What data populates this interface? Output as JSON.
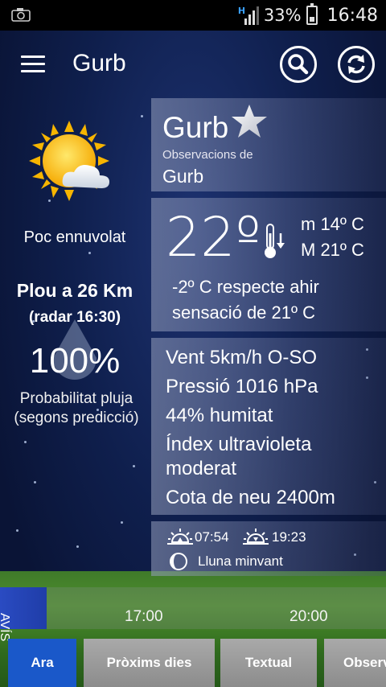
{
  "status_bar": {
    "network": "H",
    "battery": "33%",
    "time": "16:48",
    "icons": [
      "camera-icon",
      "signal-icon",
      "battery-icon"
    ]
  },
  "appbar": {
    "title": "Gurb",
    "icons": [
      "menu-icon",
      "search-icon",
      "refresh-icon"
    ]
  },
  "current": {
    "condition": "Poc ennuvolat",
    "condition_icon": "partly-cloudy-icon"
  },
  "rain": {
    "distance": "Plou a 26 Km",
    "radar": "(radar 16:30)",
    "probability": "100%",
    "probability_label_line1": "Probabilitat pluja",
    "probability_label_line2": "(segons predicció)"
  },
  "location": {
    "name": "Gurb",
    "observations_label": "Observacions de",
    "observations_location": "Gurb"
  },
  "temperature": {
    "current": "22º",
    "min": "m 14º C",
    "max": "M 21º C",
    "diff": "-2º C respecte ahir",
    "feels_like": "sensació de 21º C"
  },
  "details": {
    "wind": "Vent 5km/h O-SO",
    "pressure": "Pressió 1016 hPa",
    "humidity": "44% humitat",
    "uv_line1": "Índex ultravioleta",
    "uv_line2": "moderat",
    "snow": "Cota de neu 2400m"
  },
  "astro": {
    "sunrise": "07:54",
    "sunset": "19:23",
    "moon": "Lluna minvant"
  },
  "timeline": {
    "avis": "AVÍS",
    "labels": [
      "17:00",
      "20:00"
    ]
  },
  "tabs": [
    {
      "label": "Ara"
    },
    {
      "label": "Pròxims dies"
    },
    {
      "label": "Textual"
    },
    {
      "label": "Observ"
    }
  ],
  "colors": {
    "active_tab": "#1a58c9",
    "sky": "#0f1f4d",
    "grass": "#4e8f2c"
  }
}
